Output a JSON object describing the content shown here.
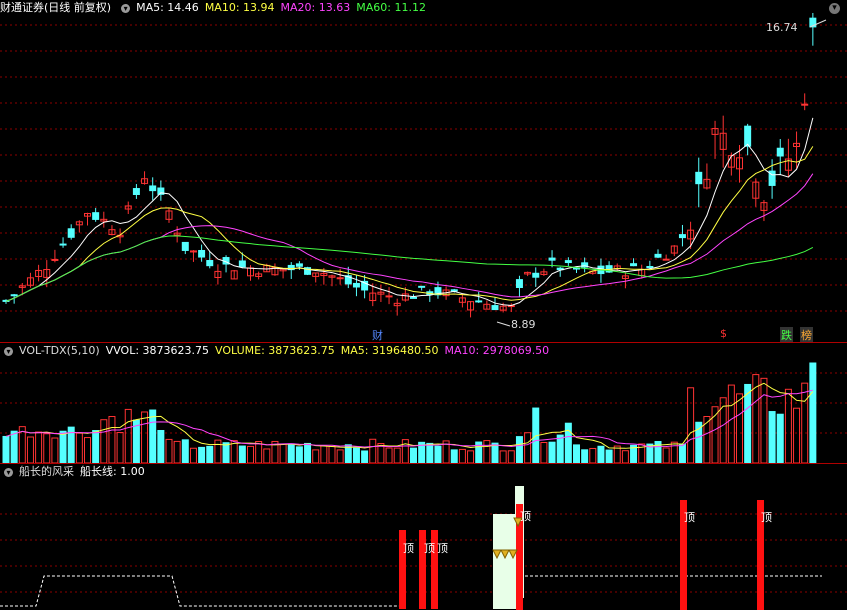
{
  "price_panel": {
    "stock_title": "财通证券",
    "period_label": "(日线 前复权)",
    "indicators": [
      {
        "label": "MA5: 14.46",
        "color": "#ffffff"
      },
      {
        "label": "MA10: 13.94",
        "color": "#ffff44"
      },
      {
        "label": "MA20: 13.63",
        "color": "#ff44ff"
      },
      {
        "label": "MA60: 11.12",
        "color": "#44ff44"
      }
    ],
    "high_label": "16.74",
    "low_label": "8.89",
    "event_markers": [
      {
        "label": "财",
        "color": "#5588ff"
      },
      {
        "label": "$",
        "color": "#ff3333"
      },
      {
        "label": "跌",
        "color": "#44ff44"
      },
      {
        "label": "榜",
        "color": "#ffaa33"
      }
    ]
  },
  "volume_panel": {
    "name": "VOL-TDX(5,10)",
    "indicators": [
      {
        "label": "VVOL: 3873623.75",
        "color": "#ffffff"
      },
      {
        "label": "VOLUME: 3873623.75",
        "color": "#ffff44"
      },
      {
        "label": "MA5: 3196480.50",
        "color": "#ffff44"
      },
      {
        "label": "MA10: 2978069.50",
        "color": "#ff44ff"
      }
    ]
  },
  "signal_panel": {
    "name": "船长的风采",
    "line_label": "船长线: 1.00",
    "top_label": "顶"
  },
  "colors": {
    "up": "#ff3333",
    "down": "#55ffff",
    "grid": "#8b0000"
  }
}
